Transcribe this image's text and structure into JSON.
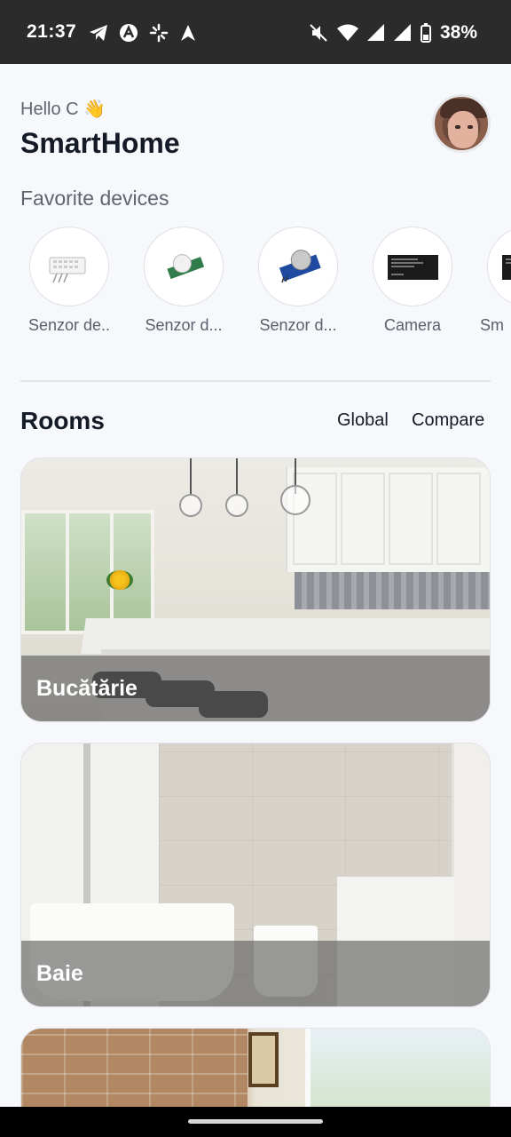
{
  "status_bar": {
    "time": "21:37",
    "battery": "38%",
    "left_icons": [
      "telegram-icon",
      "app-a-icon",
      "pinwheel-icon",
      "navigation-icon"
    ],
    "right_icons": [
      "mute-icon",
      "wifi-icon",
      "signal-icon",
      "signal-icon",
      "battery-icon"
    ]
  },
  "header": {
    "greeting": "Hello C 👋",
    "title": "SmartHome"
  },
  "favorites": {
    "title": "Favorite devices",
    "items": [
      {
        "label": "Senzor de..",
        "icon": "humidity-sensor-icon"
      },
      {
        "label": "Senzor d...",
        "icon": "motion-sensor-icon"
      },
      {
        "label": "Senzor d...",
        "icon": "gas-sensor-icon"
      },
      {
        "label": "Camera",
        "icon": "camera-screen-icon"
      },
      {
        "label": "Sm",
        "icon": "smart-screen-icon"
      }
    ]
  },
  "rooms": {
    "title": "Rooms",
    "global_label": "Global",
    "compare_label": "Compare",
    "items": [
      {
        "name": "Bucătărie"
      },
      {
        "name": "Baie"
      },
      {
        "name": ""
      }
    ]
  },
  "colors": {
    "background": "#f7f8fb",
    "text": "#141a26",
    "muted": "#5f6470",
    "statusbar": "#2b2b2b"
  }
}
